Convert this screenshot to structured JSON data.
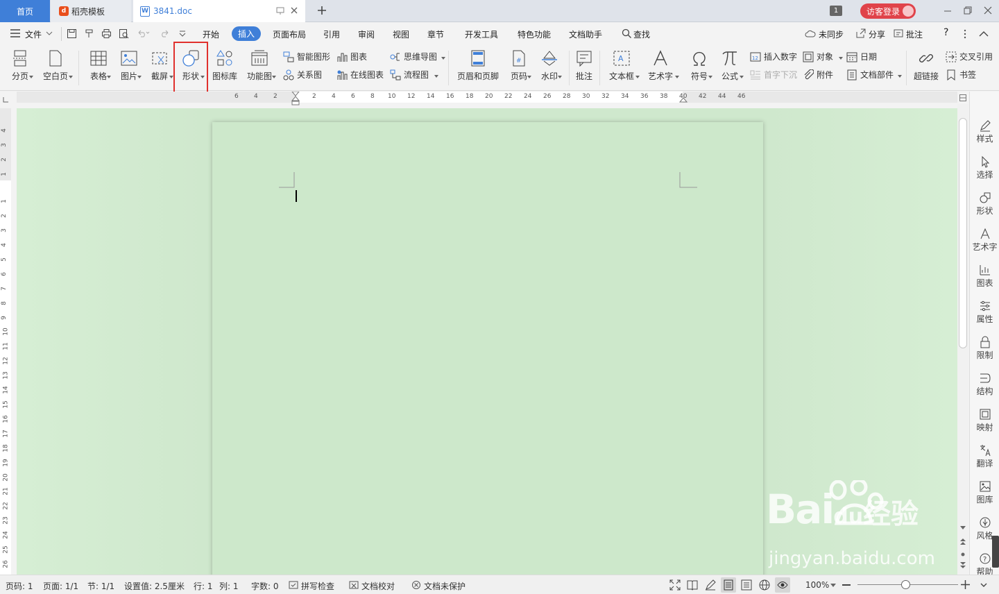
{
  "tabs": {
    "home": "首页",
    "daoke": "稻壳模板",
    "doc": "3841.doc",
    "badge": "1",
    "login": "访客登录"
  },
  "menu": {
    "file": "文件",
    "start": "开始",
    "insert": "插入",
    "layout": "页面布局",
    "ref": "引用",
    "review": "审阅",
    "view": "视图",
    "chapter": "章节",
    "devtools": "开发工具",
    "special": "特色功能",
    "assistant": "文档助手",
    "find": "查找",
    "sync": "未同步",
    "share": "分享",
    "comment": "批注",
    "help": "?"
  },
  "ribbon": {
    "page_break": "分页",
    "blank_page": "空白页",
    "table": "表格",
    "picture": "图片",
    "screenshot": "截屏",
    "shape": "形状",
    "icon_lib": "图标库",
    "func_chart": "功能图",
    "smart_graphic": "智能图形",
    "chart": "图表",
    "mindmap": "思维导图",
    "relation": "关系图",
    "online_chart": "在线图表",
    "flowchart": "流程图",
    "header_footer": "页眉和页脚",
    "page_num": "页码",
    "watermark": "水印",
    "annotation": "批注",
    "textbox": "文本框",
    "wordart": "艺术字",
    "symbol": "符号",
    "formula": "公式",
    "insert_num": "插入数字",
    "object": "对象",
    "date": "日期",
    "drop_cap": "首字下沉",
    "attachment": "附件",
    "doc_parts": "文档部件",
    "hyperlink": "超链接",
    "cross_ref": "交叉引用",
    "bookmark": "书签"
  },
  "ruler": {
    "h": [
      "6",
      "4",
      "2",
      "2",
      "4",
      "6",
      "8",
      "10",
      "12",
      "14",
      "16",
      "18",
      "20",
      "22",
      "24",
      "26",
      "28",
      "30",
      "32",
      "34",
      "36",
      "38",
      "40",
      "42",
      "44",
      "46"
    ],
    "v": [
      "4",
      "3",
      "2",
      "1",
      "1",
      "2",
      "3",
      "4",
      "5",
      "6",
      "7",
      "8",
      "9",
      "10",
      "11",
      "12",
      "13",
      "14",
      "15",
      "16",
      "17",
      "18",
      "19",
      "20",
      "21",
      "22",
      "23",
      "24",
      "25",
      "26"
    ]
  },
  "rpanel": [
    "样式",
    "选择",
    "形状",
    "艺术字",
    "图表",
    "属性",
    "限制",
    "结构",
    "映射",
    "翻译",
    "图库",
    "风格",
    "帮助"
  ],
  "status": {
    "page_num": "页码: 1",
    "pages": "页面: 1/1",
    "section": "节: 1/1",
    "setting": "设置值: 2.5厘米",
    "row": "行: 1",
    "col": "列: 1",
    "words": "字数: 0",
    "spell": "拼写检查",
    "proof": "文档校对",
    "protect": "文档未保护",
    "zoom": "100%"
  },
  "watermark": {
    "brand": "Bai",
    "suffix": "经验",
    "url": "jingyan.baidu.com"
  }
}
